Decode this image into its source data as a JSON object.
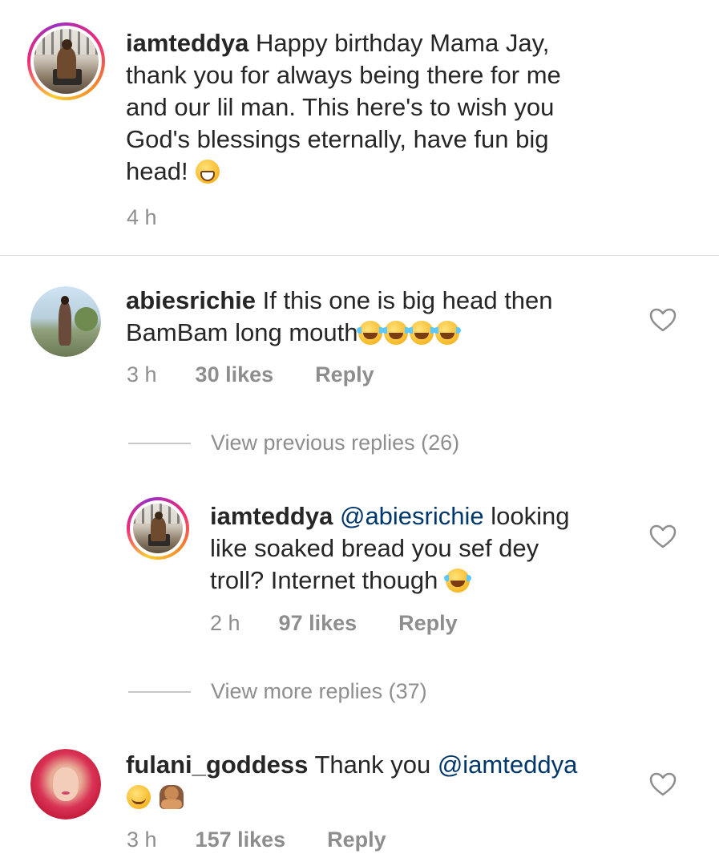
{
  "comments": [
    {
      "username": "iamteddya",
      "lines": [
        "Happy birthday Mama Jay,",
        "thank you for always being there for me",
        "and our lil man. This here's to wish you",
        "God's blessings eternally, have fun big",
        "head!"
      ],
      "emojis": [
        "grinning-face"
      ],
      "time": "4 h"
    },
    {
      "username": "abiesrichie",
      "lines": [
        "If this one is big head then",
        "BamBam long mouth"
      ],
      "emojis": [
        "face-with-tears-of-joy",
        "face-with-tears-of-joy",
        "face-with-tears-of-joy",
        "face-with-tears-of-joy"
      ],
      "time": "3 h",
      "likes": "30 likes",
      "reply": "Reply"
    },
    {
      "view_previous": "View previous replies (26)"
    },
    {
      "username": "iamteddya",
      "mention": "@abiesrichie",
      "lines": [
        "looking",
        "like soaked bread you sef dey",
        "troll? Internet though"
      ],
      "emojis": [
        "face-with-tears-of-joy"
      ],
      "time": "2 h",
      "likes": "97 likes",
      "reply": "Reply"
    },
    {
      "view_more": "View more replies (37)"
    },
    {
      "username": "fulani_goddess",
      "text_before": "Thank you",
      "mention": "@iamteddya",
      "emojis": [
        "smiling-face-with-smiling-eyes",
        "person-facepalming"
      ],
      "time": "3 h",
      "likes": "157 likes",
      "reply": "Reply"
    }
  ],
  "colors": {
    "text": "#262626",
    "secondary": "#8e8e8e",
    "mention": "#00376b",
    "divider": "#dbdbdb"
  },
  "icons": [
    "heart-outline-icon"
  ]
}
